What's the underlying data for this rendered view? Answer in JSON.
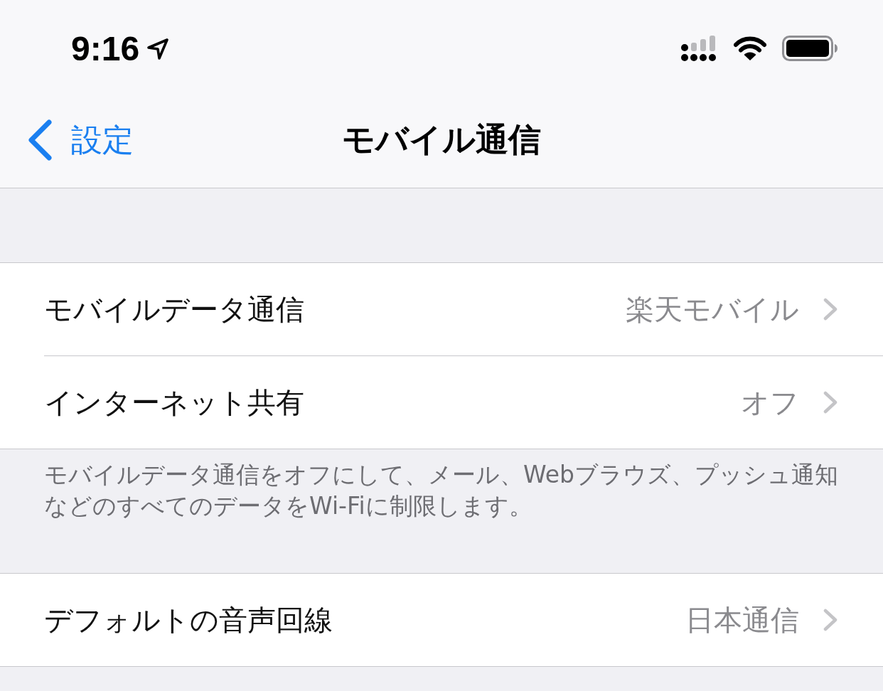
{
  "status_bar": {
    "time": "9:16"
  },
  "nav": {
    "back_label": "設定",
    "title": "モバイル通信"
  },
  "sections": [
    {
      "rows": [
        {
          "label": "モバイルデータ通信",
          "value": "楽天モバイル"
        },
        {
          "label": "インターネット共有",
          "value": "オフ"
        }
      ],
      "footer": "モバイルデータ通信をオフにして、メール、Webブラウズ、プッシュ通知などのすべてのデータをWi-Fiに制限します。"
    },
    {
      "rows": [
        {
          "label": "デフォルトの音声回線",
          "value": "日本通信"
        }
      ]
    }
  ]
}
